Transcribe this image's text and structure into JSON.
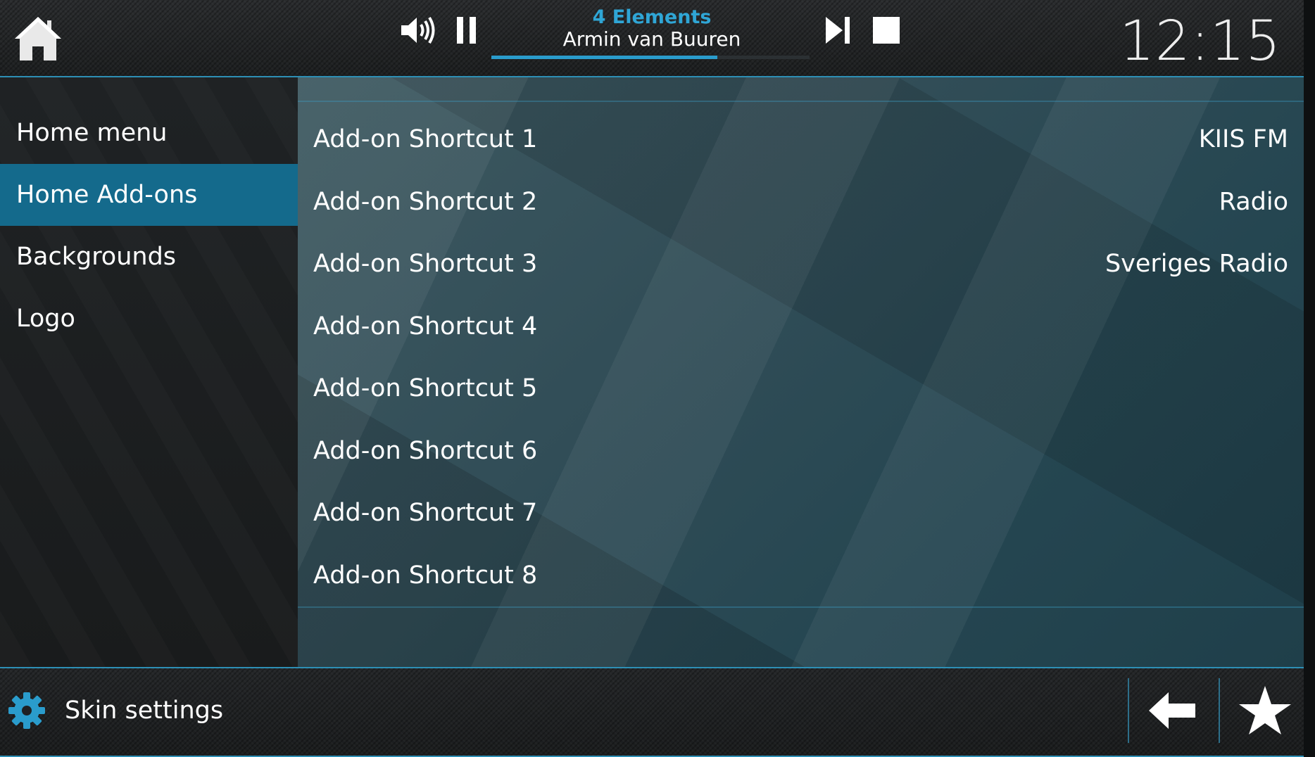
{
  "topbar": {
    "home_icon": "home-icon",
    "now_playing": {
      "label": "4 Elements",
      "artist": "Armin van Buuren",
      "progress": 0.71
    },
    "controls": {
      "volume_icon": "volume-icon",
      "pause_icon": "pause-icon",
      "next_icon": "skip-next-icon",
      "stop_icon": "stop-icon"
    },
    "clock": "12:15"
  },
  "sidebar": {
    "items": [
      {
        "label": "Home menu",
        "active": false
      },
      {
        "label": "Home Add-ons",
        "active": true
      },
      {
        "label": "Backgrounds",
        "active": false
      },
      {
        "label": "Logo",
        "active": false
      }
    ]
  },
  "main": {
    "rows": [
      {
        "label": "Add-on Shortcut 1",
        "value": "KIIS FM"
      },
      {
        "label": "Add-on Shortcut 2",
        "value": "Radio"
      },
      {
        "label": "Add-on Shortcut 3",
        "value": "Sveriges Radio"
      },
      {
        "label": "Add-on Shortcut 4",
        "value": ""
      },
      {
        "label": "Add-on Shortcut 5",
        "value": ""
      },
      {
        "label": "Add-on Shortcut 6",
        "value": ""
      },
      {
        "label": "Add-on Shortcut 7",
        "value": ""
      },
      {
        "label": "Add-on Shortcut 8",
        "value": ""
      }
    ]
  },
  "bottombar": {
    "settings_label": "Skin settings",
    "settings_icon": "gear-icon",
    "back_icon": "back-arrow-icon",
    "favourites_icon": "star-icon"
  },
  "colors": {
    "accent": "#2a9ccc",
    "active_item": "#146a8c",
    "now_playing_label": "#2fa6d6"
  }
}
